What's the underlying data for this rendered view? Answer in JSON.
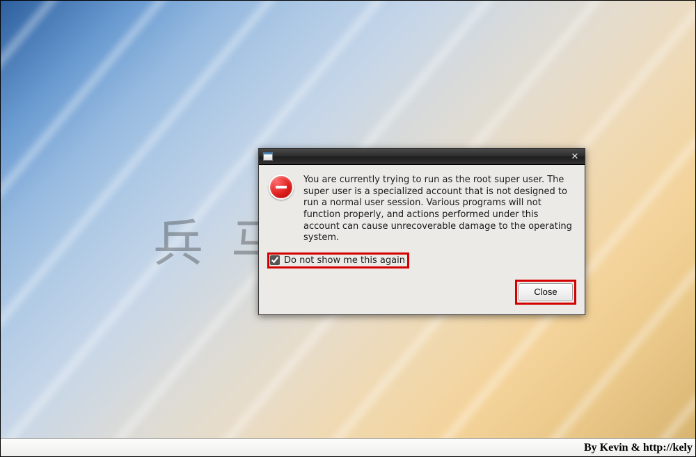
{
  "dialog": {
    "message": "You are currently trying to run as the root super user.  The super user is a specialized account that is not designed to run a normal user session.  Various programs will not function properly, and actions performed under this account can cause unrecoverable damage to the operating system.",
    "checkbox_label": "Do not show me this again",
    "checkbox_checked": true,
    "close_label": "Close",
    "icon_name": "error-icon"
  },
  "watermark_text": "兵马俑发苏",
  "footer": {
    "credit": "By Kevin & http://kely"
  },
  "colors": {
    "highlight": "#d40000"
  }
}
